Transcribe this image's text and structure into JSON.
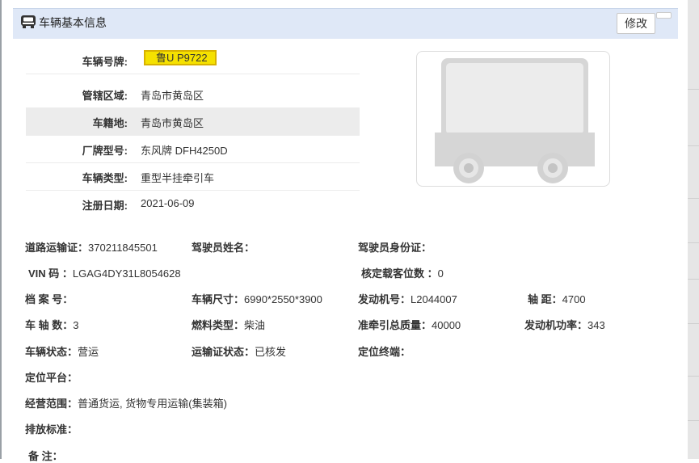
{
  "header": {
    "title": "车辆基本信息",
    "edit_label": "修改",
    "icon": "truck-icon"
  },
  "basic_rows": [
    {
      "label": "车辆号牌:",
      "value": "鲁U P9722",
      "plate": true
    },
    {
      "label": "管辖区域:",
      "value": "青岛市黄岛区"
    },
    {
      "label": "车籍地:",
      "value": "青岛市黄岛区"
    },
    {
      "label": "厂牌型号:",
      "value": "东风牌 DFH4250D"
    },
    {
      "label": "车辆类型:",
      "value": "重型半挂牵引车"
    },
    {
      "label": "注册日期:",
      "value": "2021-06-09"
    }
  ],
  "vehicle_image": {
    "icon": "truck-illustration",
    "colors": {
      "body": "#d6d6d6",
      "cab": "#e2e2e2",
      "wheel": "#c8c8c8"
    }
  },
  "details": {
    "road_permit": {
      "label": "道路运输证：",
      "value": "370211845501"
    },
    "driver_name": {
      "label": "驾驶员姓名：",
      "value": ""
    },
    "driver_id": {
      "label": "驾驶员身份证：",
      "value": ""
    },
    "vin": {
      "label": "VIN 码 ：",
      "value": "LGAG4DY31L8054628"
    },
    "seats": {
      "label": "核定载客位数 ：",
      "value": "0"
    },
    "archive_no": {
      "label": "档 案 号：",
      "value": ""
    },
    "dimensions": {
      "label": "车辆尺寸：",
      "value": "6990*2550*3900"
    },
    "engine_no": {
      "label": "发动机号：",
      "value": "L2044007"
    },
    "wheelbase": {
      "label": "轴 距：",
      "value": "4700"
    },
    "axles": {
      "label": "车 轴 数：",
      "value": "3"
    },
    "fuel": {
      "label": "燃料类型：",
      "value": "柴油"
    },
    "tow_mass": {
      "label": "准牵引总质量：",
      "value": "40000"
    },
    "engine_power": {
      "label": "发动机功率：",
      "value": "343"
    },
    "status": {
      "label": "车辆状态：",
      "value": "营运"
    },
    "permit_status": {
      "label": "运输证状态：",
      "value": "已核发"
    },
    "gps_terminal": {
      "label": "定位终端：",
      "value": ""
    },
    "gps_platform": {
      "label": "定位平台：",
      "value": ""
    },
    "scope": {
      "label": "经营范围：",
      "value": "普通货运, 货物专用运输(集装箱)"
    },
    "emission": {
      "label": "排放标准：",
      "value": ""
    },
    "remark": {
      "label": "备 注：",
      "value": ""
    }
  }
}
